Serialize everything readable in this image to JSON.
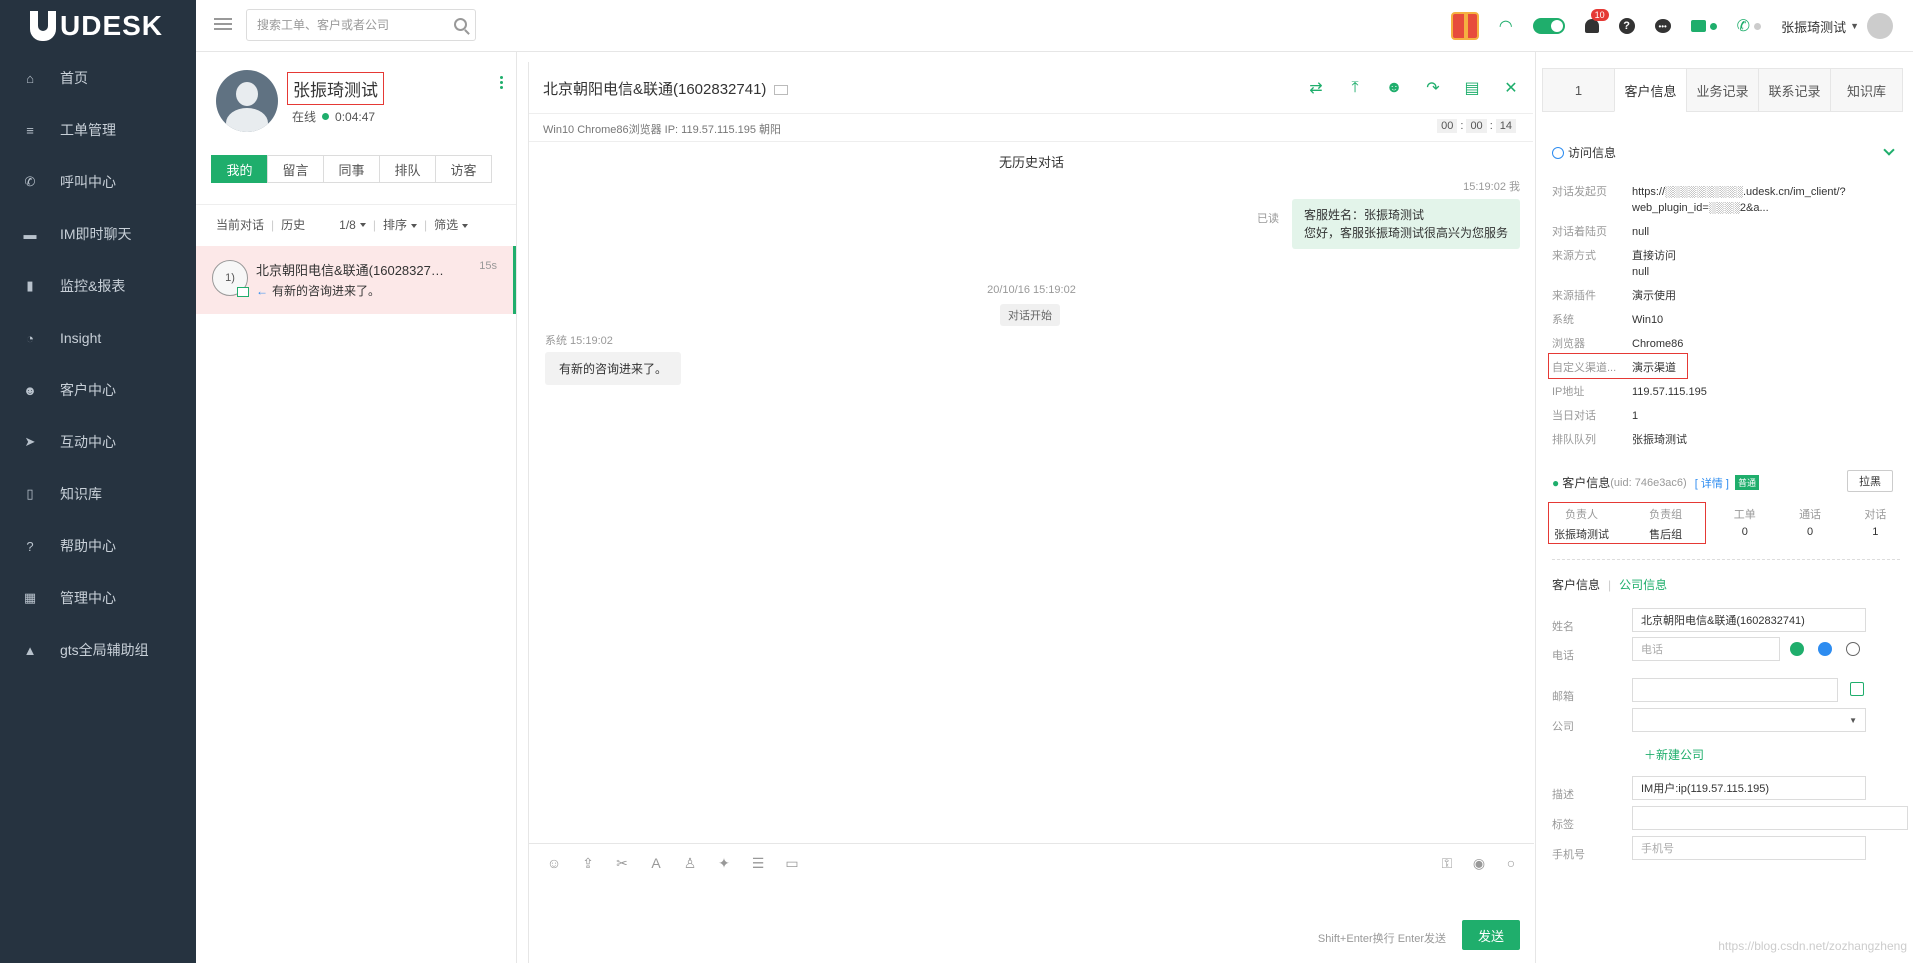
{
  "sidebar": {
    "brand": "UDESK",
    "items": [
      {
        "label": "首页",
        "icon": "home-icon",
        "glyph": "⌂"
      },
      {
        "label": "工单管理",
        "icon": "ticket-icon",
        "glyph": "≡"
      },
      {
        "label": "呼叫中心",
        "icon": "phone-icon",
        "glyph": "✆"
      },
      {
        "label": "IM即时聊天",
        "icon": "chat-icon",
        "glyph": "▬"
      },
      {
        "label": "监控&报表",
        "icon": "chart-icon",
        "glyph": "▮"
      },
      {
        "label": "Insight",
        "icon": "pie-icon",
        "glyph": "◔"
      },
      {
        "label": "客户中心",
        "icon": "users-icon",
        "glyph": "☻"
      },
      {
        "label": "互动中心",
        "icon": "send-icon",
        "glyph": "➤"
      },
      {
        "label": "知识库",
        "icon": "book-icon",
        "glyph": "▯"
      },
      {
        "label": "帮助中心",
        "icon": "help-icon",
        "glyph": "?"
      },
      {
        "label": "管理中心",
        "icon": "grid-icon",
        "glyph": "▦"
      },
      {
        "label": "gts全局辅助组",
        "icon": "triangle-icon",
        "glyph": "▲"
      }
    ]
  },
  "topbar": {
    "search_placeholder": "搜索工单、客户或者公司",
    "notification_count": "10",
    "user_name": "张振琦测试"
  },
  "agent": {
    "name": "张振琦测试",
    "status": "在线",
    "duration": "0:04:47"
  },
  "conv_tabs": [
    "我的",
    "留言",
    "同事",
    "排队",
    "访客"
  ],
  "filters": {
    "current": "当前对话",
    "history": "历史",
    "page": "1/8",
    "sort": "排序",
    "filter": "筛选"
  },
  "conversation": {
    "avatar_text": "1)",
    "title": "北京朝阳电信&联通(1602832741)",
    "time": "15s",
    "last_message": "有新的咨询进来了。"
  },
  "chat": {
    "title": "北京朝阳电信&联通(1602832741)",
    "env_info": "Win10 Chrome86浏览器   IP: 119.57.115.195 朝阳",
    "timer": [
      "00",
      "00",
      "14"
    ],
    "no_history": "无历史对话",
    "out_time": "15:19:02 我",
    "read_label": "已读",
    "out_line1": "客服姓名：张振琦测试",
    "out_line2": "您好，客服张振琦测试很高兴为您服务",
    "sys_time": "20/10/16 15:19:02",
    "sys_pill": "对话开始",
    "in_time": "系统 15:19:02",
    "in_message": "有新的咨询进来了。",
    "hint": "Shift+Enter换行 Enter发送",
    "send_label": "发送"
  },
  "right": {
    "tabs": [
      "1",
      "客户信息",
      "业务记录",
      "联系记录",
      "知识库"
    ],
    "visit_title": "访问信息",
    "visit_info": [
      {
        "k": "对话发起页",
        "v": "https://░░░░░░░░░░.udesk.cn/im_client/?web_plugin_id=░░░░2&a..."
      },
      {
        "k": "对话着陆页",
        "v": "null"
      },
      {
        "k": "来源方式",
        "v": "直接访问"
      },
      {
        "k": "",
        "v": "null"
      },
      {
        "k": "来源插件",
        "v": "演示使用"
      },
      {
        "k": "系统",
        "v": "Win10"
      },
      {
        "k": "浏览器",
        "v": "Chrome86"
      },
      {
        "k": "自定义渠道...",
        "v": "演示渠道"
      },
      {
        "k": "IP地址",
        "v": "119.57.115.195"
      },
      {
        "k": "当日对话",
        "v": "1"
      },
      {
        "k": "排队队列",
        "v": "张振琦测试"
      }
    ],
    "customer_title": "客户信息",
    "uid": "(uid: 746e3ac6)",
    "detail": "[ 详情 ]",
    "tag": "普通",
    "pull_black": "拉黑",
    "stats": [
      {
        "h": "负责人",
        "v": "张振琦测试"
      },
      {
        "h": "负责组",
        "v": "售后组"
      },
      {
        "h": "工单",
        "v": "0"
      },
      {
        "h": "通话",
        "v": "0"
      },
      {
        "h": "对话",
        "v": "1"
      }
    ],
    "ctab_a": "客户信息",
    "ctab_b": "公司信息",
    "form": {
      "name_label": "姓名",
      "name_value": "北京朝阳电信&联通(1602832741)",
      "phone_label": "电话",
      "phone_placeholder": "电话",
      "email_label": "邮箱",
      "email_value": "",
      "company_label": "公司",
      "company_value": "",
      "add_company": "＋新建公司",
      "desc_label": "描述",
      "desc_value": "IM用户:ip(119.57.115.195)",
      "tag_label": "标签",
      "tag_value": "",
      "mobile_label": "手机号",
      "mobile_placeholder": "手机号"
    }
  },
  "watermark": "https://blog.csdn.net/zozhangzheng",
  "colors": {
    "brand_green": "#1fae6c",
    "sidebar_bg": "#263340",
    "highlight_red": "#e53935"
  }
}
